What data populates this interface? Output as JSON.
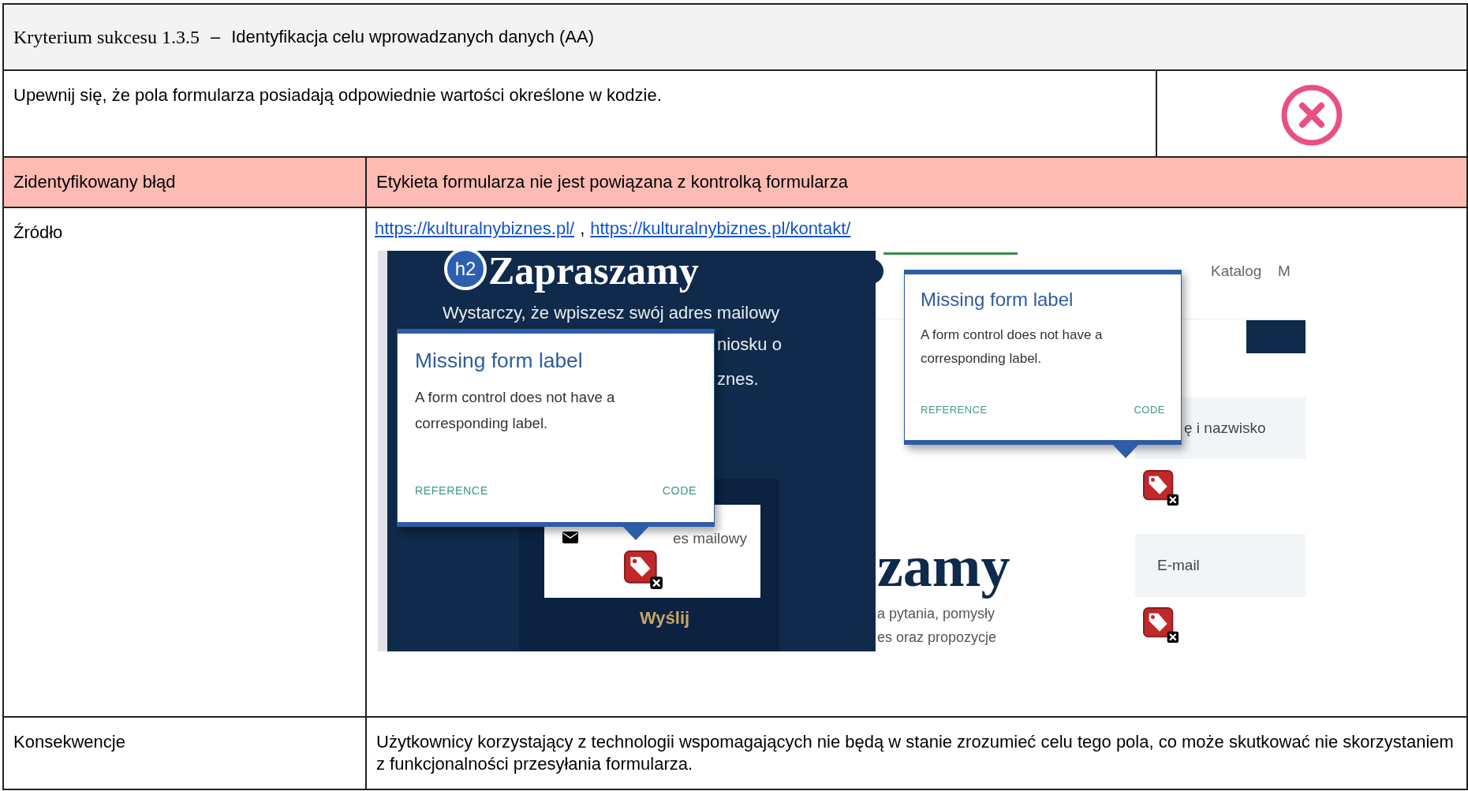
{
  "criterion": {
    "code": "Kryterium sukcesu 1.3.5",
    "dash": "–",
    "title": "Identyfikacja celu wprowadzanych danych (AA)"
  },
  "description": "Upewnij się, że pola formularza posiadają odpowiednie wartości określone w kodzie.",
  "result": {
    "passed": false
  },
  "rows": [
    {
      "kind": "error",
      "label": "Zidentyfikowany błąd",
      "value": "Etykieta formularza nie jest powiązana z kontrolką formularza"
    },
    {
      "kind": "source",
      "label": "Źródło",
      "links": [
        "https://kulturalnybiznes.pl/",
        "https://kulturalnybiznes.pl/kontakt/"
      ],
      "link_separator": ","
    },
    {
      "kind": "text",
      "label": "Konsekwencje",
      "value": "Użytkownicy korzystający z technologii wspomagających nie będą w stanie zrozumieć celu tego pola, co może skutkować nie skorzystaniem z funkcjonalności przesyłania formularza."
    }
  ],
  "screenshot_left": {
    "badge": "h2",
    "heading": "Zapraszamy",
    "lines": [
      "Wystarczy, że wpiszesz swój adres mailowy",
      "niosku o",
      "znes."
    ],
    "input_fragment": "es mailowy",
    "button": "Wyślij",
    "popup": {
      "title": "Missing form label",
      "body": "A form control does not have a corresponding label.",
      "actions": [
        "REFERENCE",
        "CODE"
      ]
    }
  },
  "screenshot_right": {
    "nav": [
      "Katalog",
      "M"
    ],
    "heading": "zamy",
    "lines": [
      "a pytania, pomysły",
      "es oraz propozycje"
    ],
    "fields": [
      "ę i nazwisko",
      "E-mail"
    ],
    "popup": {
      "title": "Missing form label",
      "body": "A form control does not have a corresponding label.",
      "actions": [
        "REFERENCE",
        "CODE"
      ]
    }
  }
}
